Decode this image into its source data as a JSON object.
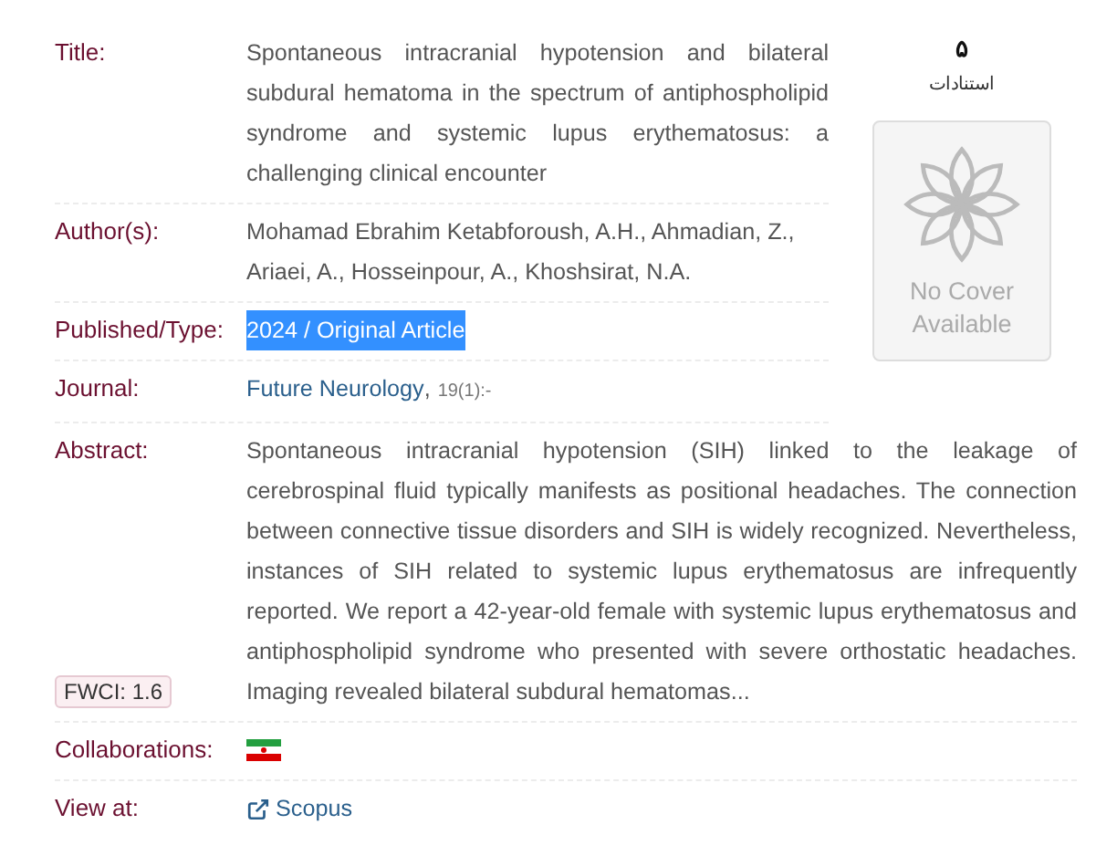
{
  "record": {
    "title": {
      "label": "Title:",
      "value": "Spontaneous intracranial hypotension and bilateral subdural hematoma in the spectrum of antiphospholipid syndrome and systemic lupus erythematosus: a challenging clinical encounter"
    },
    "authors": {
      "label": "Author(s):",
      "value": "Mohamad Ebrahim Ketabforoush, A.H., Ahmadian, Z., Ariaei, A., Hosseinpour, A., Khoshsirat, N.A."
    },
    "published": {
      "label": "Published/Type:",
      "value": "2024 / Original Article",
      "highlighted": true
    },
    "journal": {
      "label": "Journal:",
      "name": "Future Neurology",
      "separator": ",",
      "issue": "19(1):-"
    },
    "abstract": {
      "label": "Abstract:",
      "value": "Spontaneous intracranial hypotension (SIH) linked to the leakage of cerebrospinal fluid typically manifests as positional headaches. The connection between connective tissue disorders and SIH is widely recognized. Nevertheless, instances of SIH related to systemic lupus erythematosus are infrequently reported. We report a 42-year-old female with systemic lupus erythematosus and antiphospholipid syndrome who presented with severe orthostatic headaches. Imaging revealed bilateral subdural hematomas...",
      "fwci": "FWCI: 1.6"
    },
    "collaborations": {
      "label": "Collaborations:"
    },
    "view_at": {
      "label": "View at:",
      "link": "Scopus"
    }
  },
  "citations": {
    "count": "۵",
    "label": "استنادات"
  },
  "cover": {
    "text": "No Cover Available"
  }
}
